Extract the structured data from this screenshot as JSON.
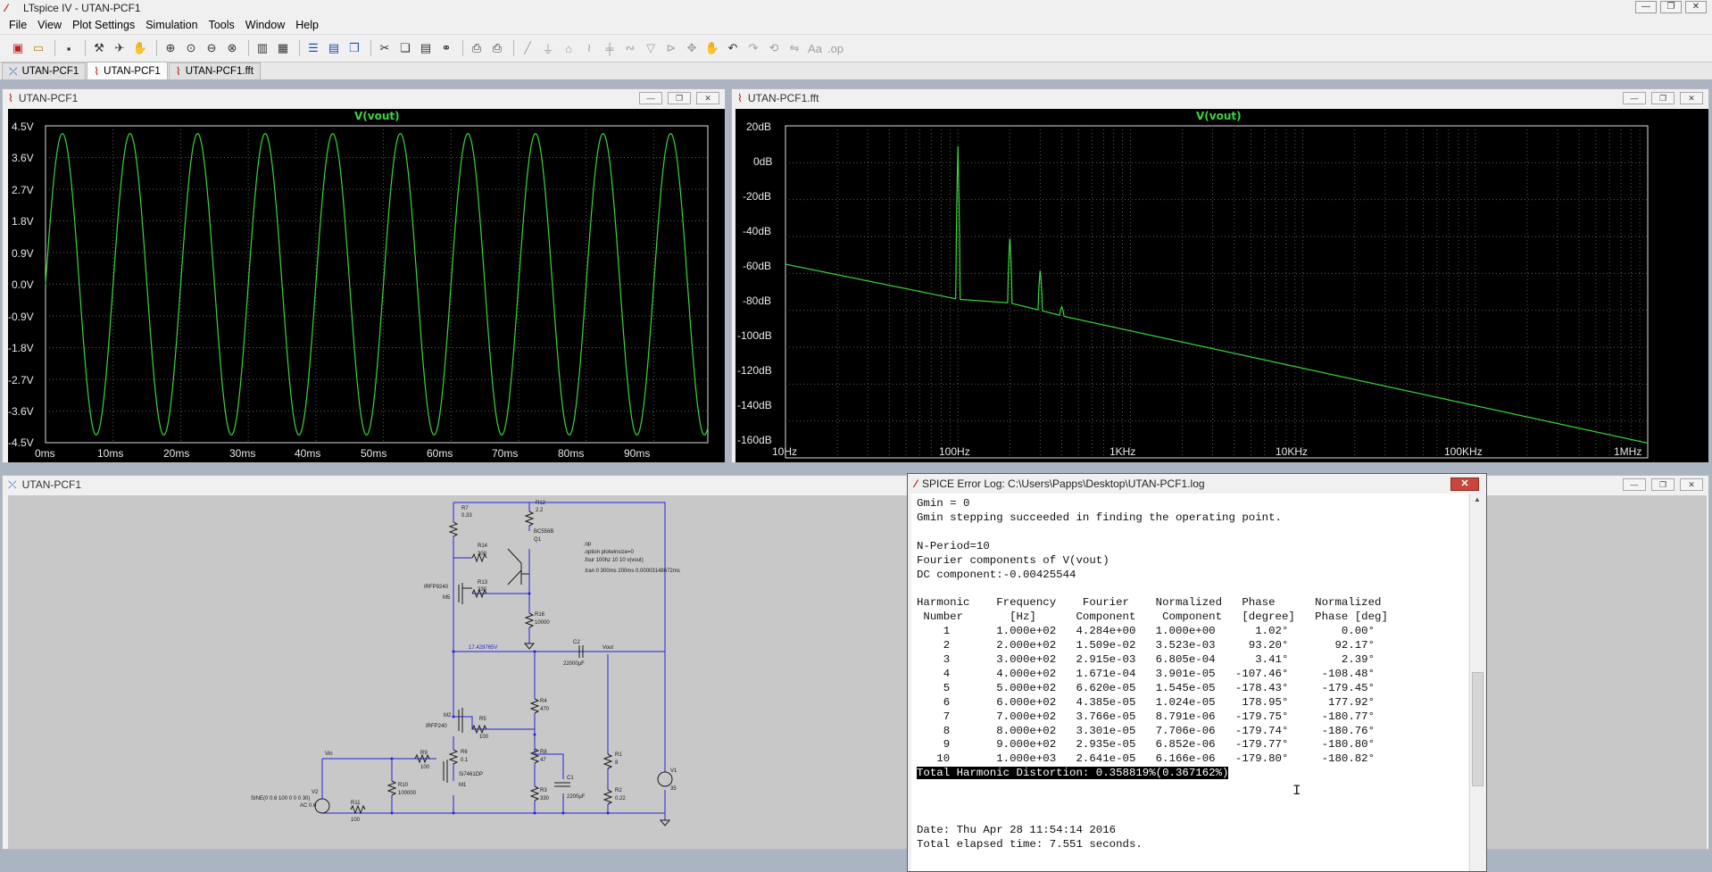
{
  "window": {
    "title": "LTspice IV - UTAN-PCF1"
  },
  "menu": [
    "File",
    "View",
    "Plot Settings",
    "Simulation",
    "Tools",
    "Window",
    "Help"
  ],
  "toolbar_icons": [
    "new-schematic-icon",
    "open-icon",
    "save-icon",
    "control-panel-icon",
    "run-icon",
    "halt-icon",
    "zoom-area-icon",
    "zoom-back-icon",
    "zoom-extents-icon",
    "zoom-cancel-icon",
    "autorange-icon",
    "axis-icon",
    "tile-horizontal-icon",
    "tile-vertical-icon",
    "cascade-icon",
    "cut-icon",
    "copy-icon",
    "paste-icon",
    "find-icon",
    "print-preview-icon",
    "print-icon",
    "wire-icon",
    "ground-icon",
    "label-icon",
    "resistor-icon",
    "capacitor-icon",
    "inductor-icon",
    "diode-icon",
    "component-icon",
    "move-icon",
    "drag-icon",
    "undo-icon",
    "redo-icon",
    "text-icon",
    "spice-directive-icon"
  ],
  "tabs": [
    {
      "label": "UTAN-PCF1",
      "icon": "schematic-icon"
    },
    {
      "label": "UTAN-PCF1",
      "icon": "waveform-icon"
    },
    {
      "label": "UTAN-PCF1.fft",
      "icon": "waveform-icon"
    }
  ],
  "time_plot": {
    "window_title": "UTAN-PCF1",
    "trace": "V(vout)",
    "color": "#3bd63b",
    "y_ticks": [
      "4.5V",
      "3.6V",
      "2.7V",
      "1.8V",
      "0.9V",
      "0.0V",
      "-0.9V",
      "-1.8V",
      "-2.7V",
      "-3.6V",
      "-4.5V"
    ],
    "x_ticks": [
      "0ms",
      "10ms",
      "20ms",
      "30ms",
      "40ms",
      "50ms",
      "60ms",
      "70ms",
      "80ms",
      "90ms"
    ]
  },
  "fft_plot": {
    "window_title": "UTAN-PCF1.fft",
    "trace": "V(vout)",
    "y_ticks": [
      "20dB",
      "0dB",
      "-20dB",
      "-40dB",
      "-60dB",
      "-80dB",
      "-100dB",
      "-120dB",
      "-140dB",
      "-160dB"
    ],
    "x_ticks": [
      "10Hz",
      "100Hz",
      "1KHz",
      "10KHz",
      "100KHz",
      "1MHz"
    ]
  },
  "chart_data": [
    {
      "type": "line",
      "title": "V(vout)",
      "xlabel": "",
      "ylabel": "",
      "xlim": [
        0,
        98
      ],
      "ylim": [
        -4.5,
        4.5
      ],
      "series": [
        {
          "name": "V(vout)",
          "waveform": "sine",
          "frequency_hz": 100,
          "amplitude_v": 4.28,
          "x_unit": "ms"
        }
      ]
    },
    {
      "type": "line",
      "title": "V(vout)",
      "xlabel": "",
      "ylabel": "",
      "x_scale": "log",
      "xlim": [
        10,
        1000000
      ],
      "ylim": [
        -160,
        20
      ],
      "series": [
        {
          "name": "V(vout)",
          "x": [
            10,
            100,
            200,
            300,
            400,
            500,
            1000000
          ],
          "y": [
            -55,
            -74,
            -76,
            -80,
            -83,
            -85,
            -152
          ],
          "peaks": [
            {
              "x": 100,
              "y": 9
            },
            {
              "x": 200,
              "y": -40
            },
            {
              "x": 300,
              "y": -58
            },
            {
              "x": 400,
              "y": -78
            }
          ]
        }
      ]
    }
  ],
  "schematic": {
    "window_title": "UTAN-PCF1",
    "labels": {
      "r7": "R7",
      "r7v": "0.33",
      "r12": "R12",
      "r12v": "2.2",
      "r14": "R14",
      "r14v": "300",
      "q1": "BC556B",
      "q1n": "Q1",
      "r13": "R13",
      "r13v": "330",
      "m5": "IRFP9240",
      "m5n": "M5",
      "r16": "R16",
      "r16v": "10000",
      "dir1": ";op",
      "dir2": ".option plotwinsize=0",
      "dir3": ".four 100hz 10 10 v(vout)",
      "dir4": ".tran 0 300ms 200ms 0.00003148672ms",
      "node": "17.429765V",
      "c2": "C2",
      "c2v": "22000µF",
      "vout": "Vout",
      "r4": "R4",
      "r4v": "470",
      "m2": "M2",
      "m2v": "IRFP240",
      "r5": "R5",
      "r5v": "100",
      "r6": "R6",
      "r6v": "0.1",
      "r8": "R8",
      "r8v": "47",
      "r1": "R1",
      "r1v": "8",
      "vin": "Vin",
      "r9": "R9",
      "r9v": "100",
      "m1v": "Si7461DP",
      "m1": "M1",
      "v1": "V1",
      "v1v": "35",
      "v2": "V2",
      "r10": "R10",
      "r10v": "100000",
      "c1": "C1",
      "c1v": "2200µF",
      "r3": "R3",
      "r3v": "330",
      "r2": "R2",
      "r2v": "0.22",
      "sine": "SINE(0 0.6 100 0 0 0 30)",
      "ac": "AC 0.6",
      "r11": "R11",
      "r11v": "100"
    }
  },
  "log": {
    "title": "SPICE Error Log: C:\\Users\\Papps\\Desktop\\UTAN-PCF1.log",
    "close_label": "✕",
    "lines": [
      "Gmin = 0",
      "Gmin stepping succeeded in finding the operating point.",
      "",
      "N-Period=10",
      "Fourier components of V(vout)",
      "DC component:-0.00425544",
      "",
      "Harmonic    Frequency    Fourier    Normalized   Phase      Normalized",
      " Number       [Hz]      Component    Component   [degree]   Phase [deg]",
      "    1       1.000e+02   4.284e+00   1.000e+00      1.02°        0.00°",
      "    2       2.000e+02   1.509e-02   3.523e-03     93.20°       92.17°",
      "    3       3.000e+02   2.915e-03   6.805e-04      3.41°        2.39°",
      "    4       4.000e+02   1.671e-04   3.901e-05   -107.46°     -108.48°",
      "    5       5.000e+02   6.620e-05   1.545e-05   -178.43°     -179.45°",
      "    6       6.000e+02   4.385e-05   1.024e-05    178.95°      177.92°",
      "    7       7.000e+02   3.766e-05   8.791e-06   -179.75°     -180.77°",
      "    8       8.000e+02   3.301e-05   7.706e-06   -179.74°     -180.76°",
      "    9       9.000e+02   2.935e-05   6.852e-06   -179.77°     -180.80°",
      "   10       1.000e+03   2.641e-05   6.166e-06   -179.80°     -180.82°"
    ],
    "thd": "Total Harmonic Distortion: 0.358819%(0.367162%)",
    "date": "Date: Thu Apr 28 11:54:14 2016",
    "elapsed": "Total elapsed time: 7.551 seconds."
  }
}
